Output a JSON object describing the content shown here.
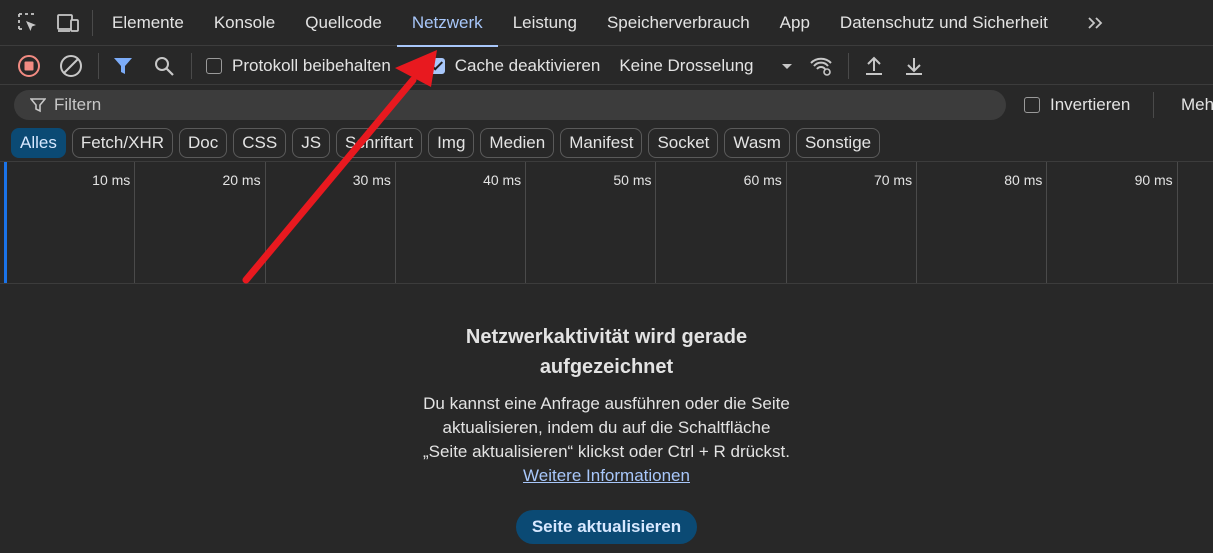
{
  "tabs": [
    {
      "label": "Elemente",
      "active": false
    },
    {
      "label": "Konsole",
      "active": false
    },
    {
      "label": "Quellcode",
      "active": false
    },
    {
      "label": "Netzwerk",
      "active": true
    },
    {
      "label": "Leistung",
      "active": false
    },
    {
      "label": "Speicherverbrauch",
      "active": false
    },
    {
      "label": "App",
      "active": false
    },
    {
      "label": "Datenschutz und Sicherheit",
      "active": false
    }
  ],
  "toolbar": {
    "preserve_log_label": "Protokoll beibehalten",
    "preserve_log_checked": false,
    "disable_cache_label": "Cache deaktivieren",
    "disable_cache_checked": true,
    "throttling_value": "Keine Drosselung"
  },
  "filter": {
    "placeholder": "Filtern",
    "invert_label": "Invertieren",
    "more_label": "Meh"
  },
  "chips": [
    {
      "label": "Alles",
      "active": true
    },
    {
      "label": "Fetch/XHR",
      "active": false
    },
    {
      "label": "Doc",
      "active": false
    },
    {
      "label": "CSS",
      "active": false
    },
    {
      "label": "JS",
      "active": false
    },
    {
      "label": "Schriftart",
      "active": false
    },
    {
      "label": "Img",
      "active": false
    },
    {
      "label": "Medien",
      "active": false
    },
    {
      "label": "Manifest",
      "active": false
    },
    {
      "label": "Socket",
      "active": false
    },
    {
      "label": "Wasm",
      "active": false
    },
    {
      "label": "Sonstige",
      "active": false
    }
  ],
  "timeline": {
    "ticks": [
      "10 ms",
      "20 ms",
      "30 ms",
      "40 ms",
      "50 ms",
      "60 ms",
      "70 ms",
      "80 ms",
      "90 ms"
    ]
  },
  "empty_state": {
    "title": "Netzwerkaktivität wird gerade aufgezeichnet",
    "body": "Du kannst eine Anfrage ausführen oder die Seite aktualisieren, indem du auf die Schaltfläche „Seite aktualisieren“ klickst oder Ctrl + R drückst.",
    "link": "Weitere Informationen",
    "button": "Seite aktualisieren"
  },
  "colors": {
    "accent": "#a8c7fa",
    "record": "#f28b82",
    "arrow": "#e8191f"
  }
}
